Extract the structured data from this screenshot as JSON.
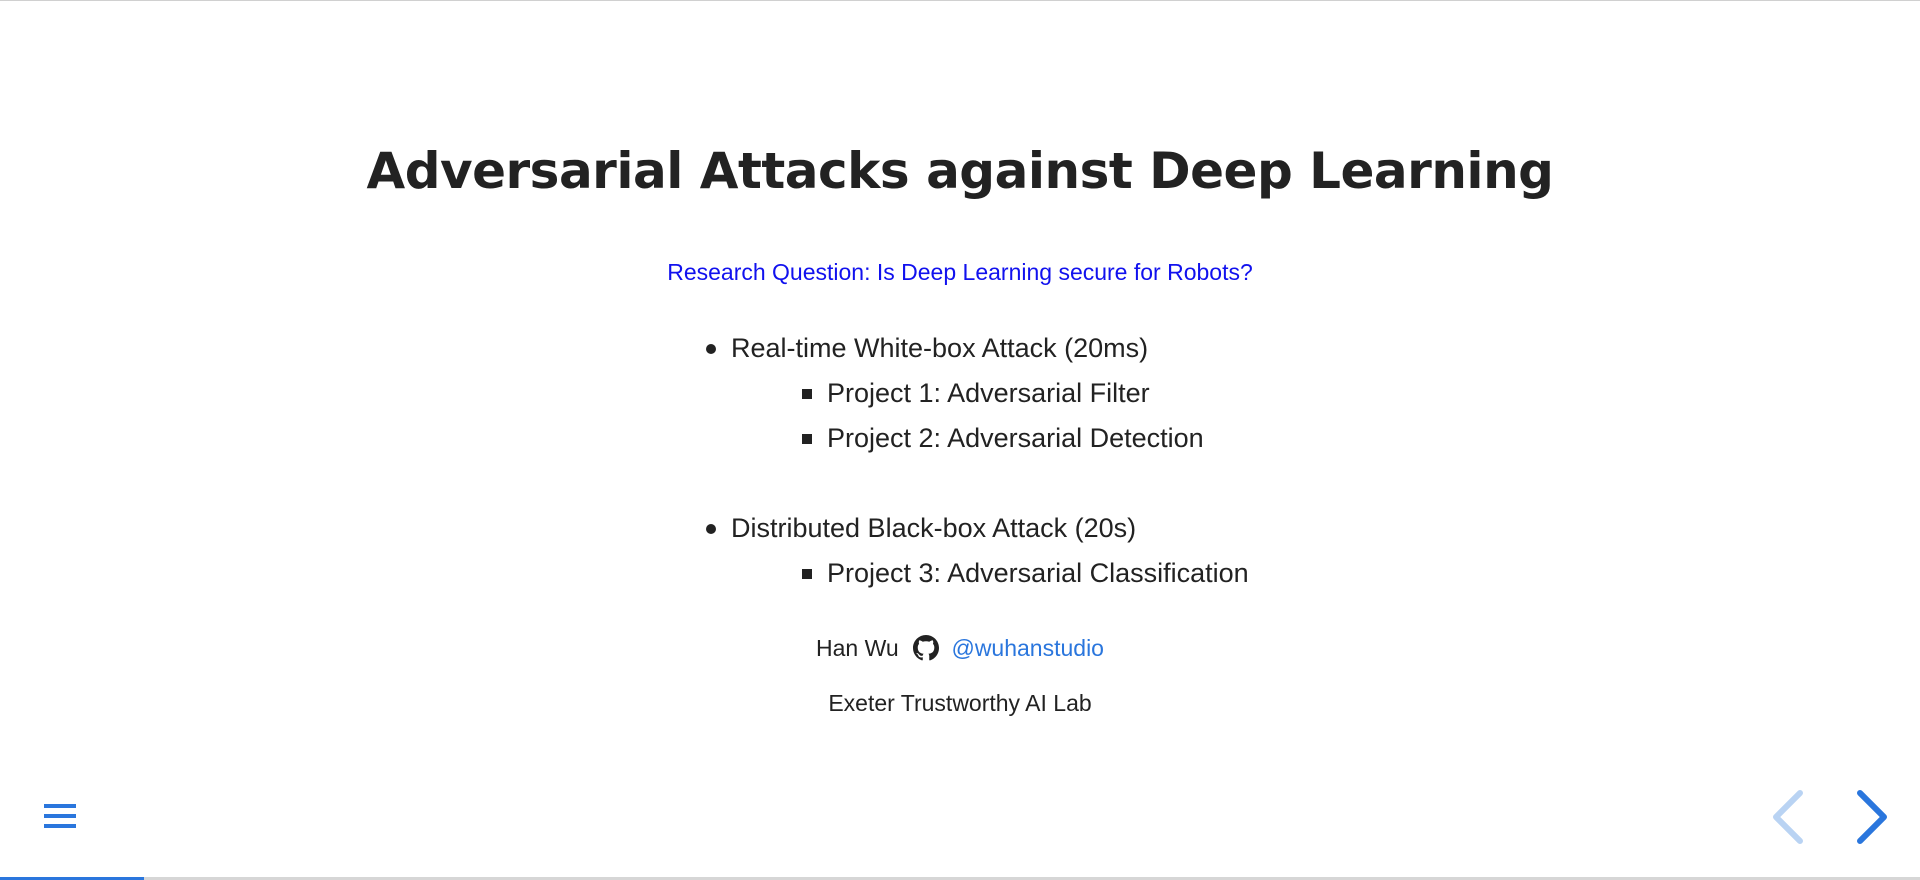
{
  "slide": {
    "title": "Adversarial Attacks against Deep Learning",
    "research_question": "Research Question: Is Deep Learning secure for Robots?",
    "outline": [
      {
        "label": "Real-time White-box Attack (20ms)",
        "children": [
          "Project 1: Adversarial Filter",
          "Project 2: Adversarial Detection"
        ]
      },
      {
        "label": "Distributed Black-box Attack (20s)",
        "children": [
          "Project 3: Adversarial Classification"
        ]
      }
    ],
    "author": {
      "name": "Han Wu",
      "icon": "github-icon",
      "handle": "@wuhanstudio"
    },
    "affiliation": "Exeter Trustworthy AI Lab"
  },
  "controls": {
    "menu_icon": "hamburger-icon",
    "prev_icon": "chevron-left-icon",
    "next_icon": "chevron-right-icon",
    "prev_enabled": false,
    "next_enabled": true
  },
  "progress": {
    "fraction": 0.075
  },
  "colors": {
    "text": "#222222",
    "research_question": "#1111ee",
    "accent": "#2a76dd",
    "accent_disabled": "#b9d3f3"
  }
}
